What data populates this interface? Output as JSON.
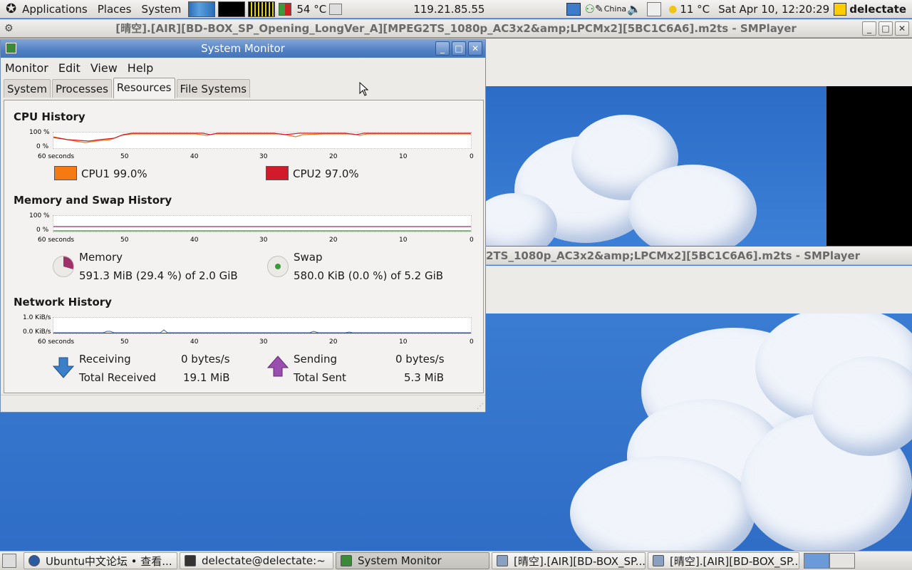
{
  "top_panel": {
    "applications": "Applications",
    "places": "Places",
    "system": "System",
    "temperature": "54 °C",
    "ip": "119.21.85.55",
    "input_method": "China",
    "weather": "11 °C",
    "clock": "Sat Apr 10, 12:20:29",
    "user": "delectate"
  },
  "smplayer_title": "[晴空].[AIR][BD-BOX_SP_Opening_LongVer_A][MPEG2TS_1080p_AC3x2&amp;LPCMx2][5BC1C6A6].m2ts - SMPlayer",
  "smplayer_title_partial": "2TS_1080p_AC3x2&amp;LPCMx2][5BC1C6A6].m2ts - SMPlayer",
  "sysmon": {
    "title": "System Monitor",
    "menu": [
      "Monitor",
      "Edit",
      "View",
      "Help"
    ],
    "tabs": [
      "System",
      "Processes",
      "Resources",
      "File Systems"
    ],
    "active_tab": "Resources",
    "x_ticks": [
      "60 seconds",
      "50",
      "40",
      "30",
      "20",
      "10",
      "0"
    ],
    "cpu": {
      "title": "CPU History",
      "y_top": "100 %",
      "y_bottom": "0 %",
      "cpu1_label": "CPU1",
      "cpu1_value": "99.0%",
      "cpu1_color": "#f57a12",
      "cpu2_label": "CPU2",
      "cpu2_value": "97.0%",
      "cpu2_color": "#d11a2a"
    },
    "memory": {
      "title": "Memory and Swap History",
      "y_top": "100 %",
      "y_bottom": "0 %",
      "mem_label": "Memory",
      "mem_value": "591.3 MiB (29.4 %) of 2.0 GiB",
      "mem_fraction": 0.294,
      "swap_label": "Swap",
      "swap_value": "580.0 KiB (0.0 %) of 5.2 GiB",
      "swap_fraction": 0.0
    },
    "network": {
      "title": "Network History",
      "y_top": "1.0 KiB/s",
      "y_bottom": "0.0 KiB/s",
      "receiving_label": "Receiving",
      "receiving_value": "0 bytes/s",
      "total_received_label": "Total Received",
      "total_received_value": "19.1 MiB",
      "sending_label": "Sending",
      "sending_value": "0 bytes/s",
      "total_sent_label": "Total Sent",
      "total_sent_value": "5.3 MiB"
    }
  },
  "taskbar": [
    {
      "label": "Ubuntu中文论坛 • 查看...",
      "icon": "firefox-icon"
    },
    {
      "label": "delectate@delectate:~",
      "icon": "terminal-icon"
    },
    {
      "label": "System Monitor",
      "icon": "system-monitor-icon"
    },
    {
      "label": "[晴空].[AIR][BD-BOX_SP...",
      "icon": "smplayer-icon"
    },
    {
      "label": "[晴空].[AIR][BD-BOX_SP...",
      "icon": "smplayer-icon"
    }
  ]
}
